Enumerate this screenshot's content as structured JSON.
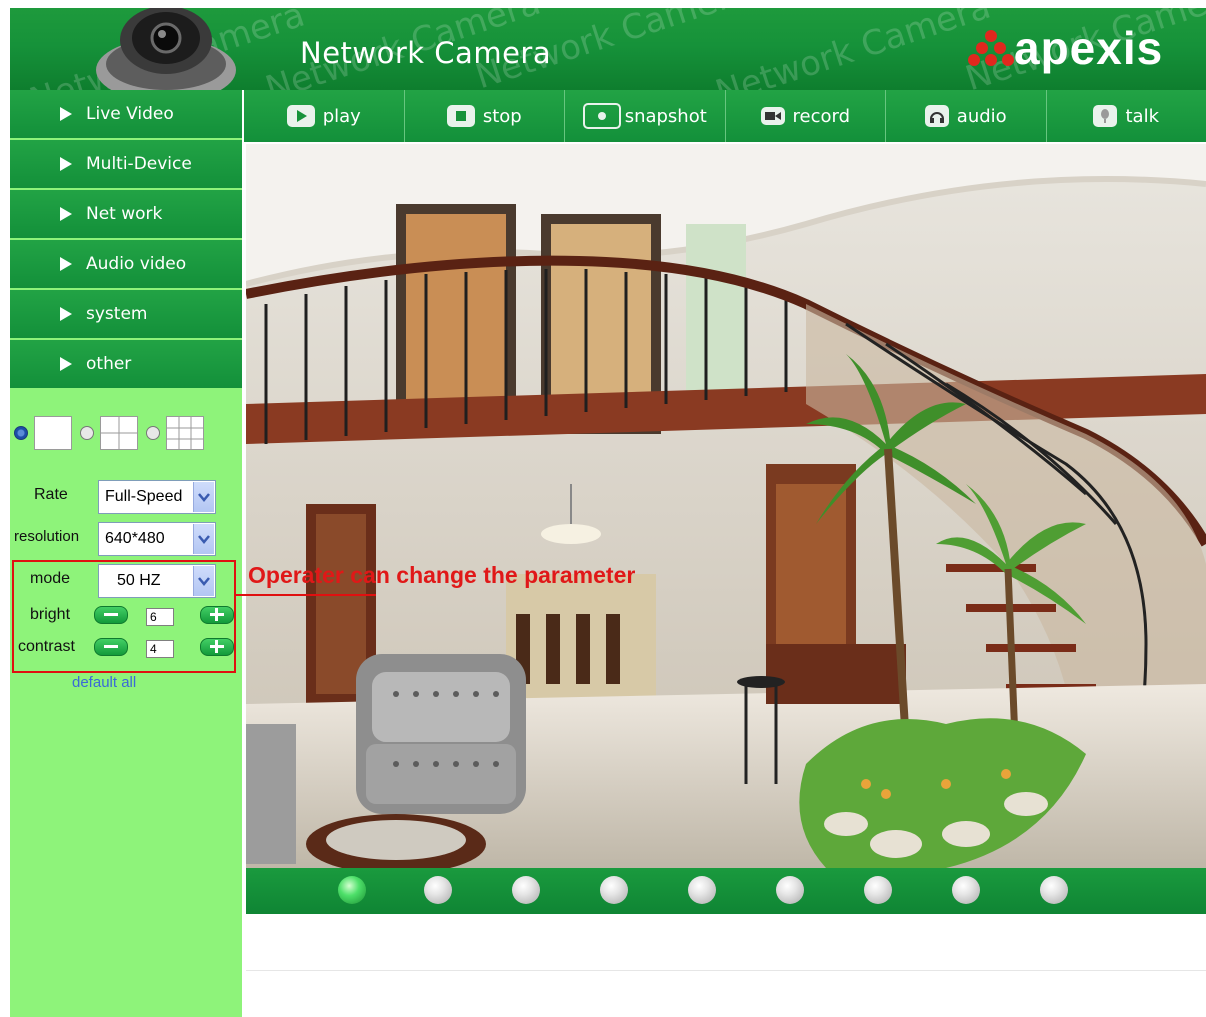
{
  "header": {
    "title": "Network Camera",
    "brand": "apexis",
    "watermark": "Network Camera",
    "colors": {
      "header_green": "#16923a",
      "brand_red": "#e0281e"
    }
  },
  "sidebar": {
    "items": [
      {
        "label": "Live Video"
      },
      {
        "label": "Multi-Device"
      },
      {
        "label": "Net work"
      },
      {
        "label": "Audio video"
      },
      {
        "label": "system"
      },
      {
        "label": "other"
      }
    ],
    "layout_options": [
      "single-view",
      "quad-view",
      "nine-view"
    ],
    "selected_layout": "single-view"
  },
  "controls": {
    "rate": {
      "label": "Rate",
      "value": "Full-Speed"
    },
    "resolution": {
      "label": "resolution",
      "value": "640*480"
    },
    "mode": {
      "label": "mode",
      "value": "50 HZ"
    },
    "bright": {
      "label": "bright",
      "value": "6"
    },
    "contrast": {
      "label": "contrast",
      "value": "4"
    },
    "default_all": "default all"
  },
  "toolbar": {
    "buttons": [
      {
        "label": "play",
        "icon": "play-icon"
      },
      {
        "label": "stop",
        "icon": "stop-icon"
      },
      {
        "label": "snapshot",
        "icon": "camera-icon"
      },
      {
        "label": "record",
        "icon": "video-record-icon"
      },
      {
        "label": "audio",
        "icon": "headphone-icon"
      },
      {
        "label": "talk",
        "icon": "microphone-icon"
      }
    ]
  },
  "presets": {
    "count": 9,
    "active_index": 0
  },
  "annotation": {
    "text": "Operater can change the parameter"
  }
}
